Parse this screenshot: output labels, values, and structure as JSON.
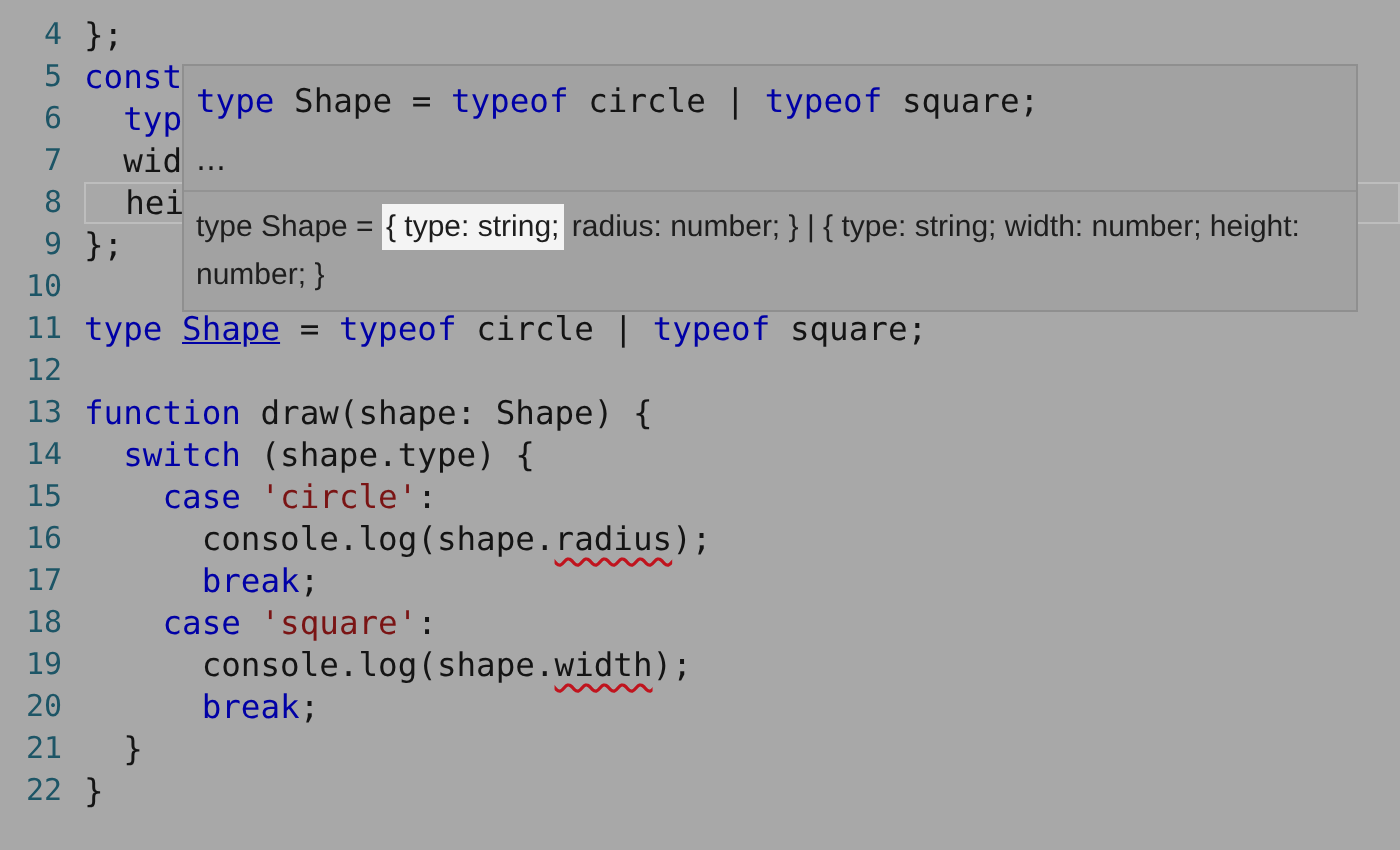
{
  "editor": {
    "lines": [
      {
        "number": "4",
        "current": false,
        "tokens": [
          {
            "kind": "plain",
            "text": "};"
          }
        ]
      },
      {
        "number": "5",
        "current": false,
        "tokens": [
          {
            "kind": "keyword",
            "text": "const"
          }
        ]
      },
      {
        "number": "6",
        "current": false,
        "tokens": [
          {
            "kind": "keyword",
            "text": "  typ"
          }
        ]
      },
      {
        "number": "7",
        "current": false,
        "tokens": [
          {
            "kind": "plain",
            "text": "  wid"
          }
        ]
      },
      {
        "number": "8",
        "current": true,
        "tokens": [
          {
            "kind": "plain",
            "text": "  hei"
          }
        ]
      },
      {
        "number": "9",
        "current": false,
        "tokens": [
          {
            "kind": "plain",
            "text": "};"
          }
        ]
      },
      {
        "number": "10",
        "current": false
      },
      {
        "number": "11",
        "current": false,
        "tokens": [
          {
            "kind": "keyword",
            "text": "type "
          },
          {
            "kind": "link",
            "text": "Shape"
          },
          {
            "kind": "plain",
            "text": " = "
          },
          {
            "kind": "keyword",
            "text": "typeof"
          },
          {
            "kind": "plain",
            "text": " circle | "
          },
          {
            "kind": "keyword",
            "text": "typeof"
          },
          {
            "kind": "plain",
            "text": " square;"
          }
        ]
      },
      {
        "number": "12",
        "current": false
      },
      {
        "number": "13",
        "current": false,
        "tokens": [
          {
            "kind": "keyword",
            "text": "function"
          },
          {
            "kind": "plain",
            "text": " draw(shape: Shape) {"
          }
        ]
      },
      {
        "number": "14",
        "current": false,
        "tokens": [
          {
            "kind": "keyword",
            "text": "  switch"
          },
          {
            "kind": "plain",
            "text": " (shape.type) {"
          }
        ]
      },
      {
        "number": "15",
        "current": false,
        "tokens": [
          {
            "kind": "keyword",
            "text": "    case "
          },
          {
            "kind": "string",
            "text": "'circle'"
          },
          {
            "kind": "plain",
            "text": ":"
          }
        ]
      },
      {
        "number": "16",
        "current": false,
        "tokens": [
          {
            "kind": "plain",
            "text": "      console.log(shape."
          },
          {
            "kind": "error",
            "text": "radius"
          },
          {
            "kind": "plain",
            "text": ");"
          }
        ]
      },
      {
        "number": "17",
        "current": false,
        "tokens": [
          {
            "kind": "keyword",
            "text": "      break"
          },
          {
            "kind": "plain",
            "text": ";"
          }
        ]
      },
      {
        "number": "18",
        "current": false,
        "tokens": [
          {
            "kind": "keyword",
            "text": "    case "
          },
          {
            "kind": "string",
            "text": "'square'"
          },
          {
            "kind": "plain",
            "text": ":"
          }
        ]
      },
      {
        "number": "19",
        "current": false,
        "tokens": [
          {
            "kind": "plain",
            "text": "      console.log(shape."
          },
          {
            "kind": "error",
            "text": "width"
          },
          {
            "kind": "plain",
            "text": ");"
          }
        ]
      },
      {
        "number": "20",
        "current": false,
        "tokens": [
          {
            "kind": "keyword",
            "text": "      break"
          },
          {
            "kind": "plain",
            "text": ";"
          }
        ]
      },
      {
        "number": "21",
        "current": false,
        "tokens": [
          {
            "kind": "plain",
            "text": "  }"
          }
        ]
      },
      {
        "number": "22",
        "current": false,
        "tokens": [
          {
            "kind": "plain",
            "text": "}"
          }
        ]
      }
    ]
  },
  "hover_tooltip": {
    "signature": [
      {
        "kind": "keyword",
        "text": "type"
      },
      {
        "kind": "plain",
        "text": " Shape = "
      },
      {
        "kind": "keyword",
        "text": "typeof"
      },
      {
        "kind": "plain",
        "text": " circle | "
      },
      {
        "kind": "keyword",
        "text": "typeof"
      },
      {
        "kind": "plain",
        "text": " square;"
      }
    ],
    "ellipsis": "…",
    "expansion": [
      {
        "text": "type Shape = ",
        "highlighted": false
      },
      {
        "text": "{ type: string;",
        "highlighted": true
      },
      {
        "text": " radius: number; } | { type: string; width: number; height: number; }",
        "highlighted": false
      }
    ]
  }
}
